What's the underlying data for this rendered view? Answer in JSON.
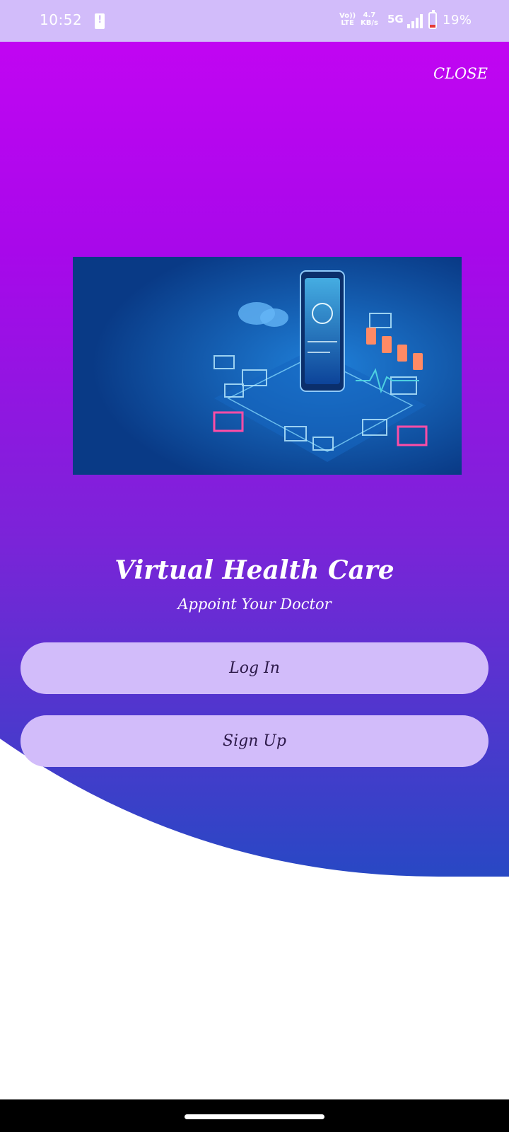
{
  "status_bar": {
    "time": "10:52",
    "volte_top": "Vo))",
    "volte_bottom": "LTE",
    "speed_value": "4.7",
    "speed_unit": "KB/s",
    "network": "5G",
    "battery_percent": "19%",
    "battery_level": 0.19,
    "battery_color": "#e53935"
  },
  "header": {
    "close_label": "CLOSE"
  },
  "banner": {
    "icon": "healthcare-technology-illustration"
  },
  "app": {
    "title": "Virtual Health Care",
    "subtitle": "Appoint Your Doctor"
  },
  "actions": {
    "login_label": "Log In",
    "signup_label": "Sign Up"
  },
  "colors": {
    "gradient_top": "#c105f2",
    "gradient_bottom": "#2848c4",
    "button_bg": "#d2bcfa",
    "status_bar_bg": "#d2bcfa"
  }
}
